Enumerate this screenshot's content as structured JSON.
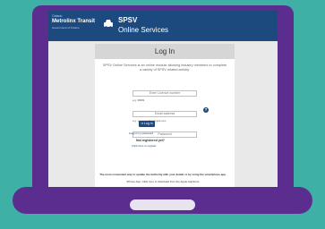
{
  "colors": {
    "background": "#3fb0a6",
    "laptop": "#5b2d8e",
    "header": "#1c4a7f",
    "login_title_bar": "#d6d6d6",
    "button": "#1c4a7f"
  },
  "brand": {
    "line1": "Ontario",
    "line2": "Metrolinx Transit",
    "line3": "Government of Ontario"
  },
  "header": {
    "icon": "car-icon",
    "title": "SPSV",
    "subtitle": "Online Services"
  },
  "login": {
    "title": "Log In",
    "intro": "SPSV Online Services is an online module allowing industry members to complete a variety of SPSV related activity.",
    "licence_placeholder": "Enter Licence number",
    "licence_hint": "e.g. 99999",
    "email_placeholder": "Email address",
    "email_hint": "e.g. yourname@example.com",
    "password_placeholder": "Password",
    "help_icon": "question-icon",
    "button_label": "Log In",
    "forgot_link": "Forgot my password",
    "not_registered": "Not registered yet?",
    "register_link": "Click here to register"
  },
  "footer": {
    "note": "The most convenient way to update the Authority with your details is by using the smartphone app.",
    "app_prefix": "iPhone App: Click",
    "app_link": "here",
    "app_suffix": "to download from the Apple AppStore"
  }
}
